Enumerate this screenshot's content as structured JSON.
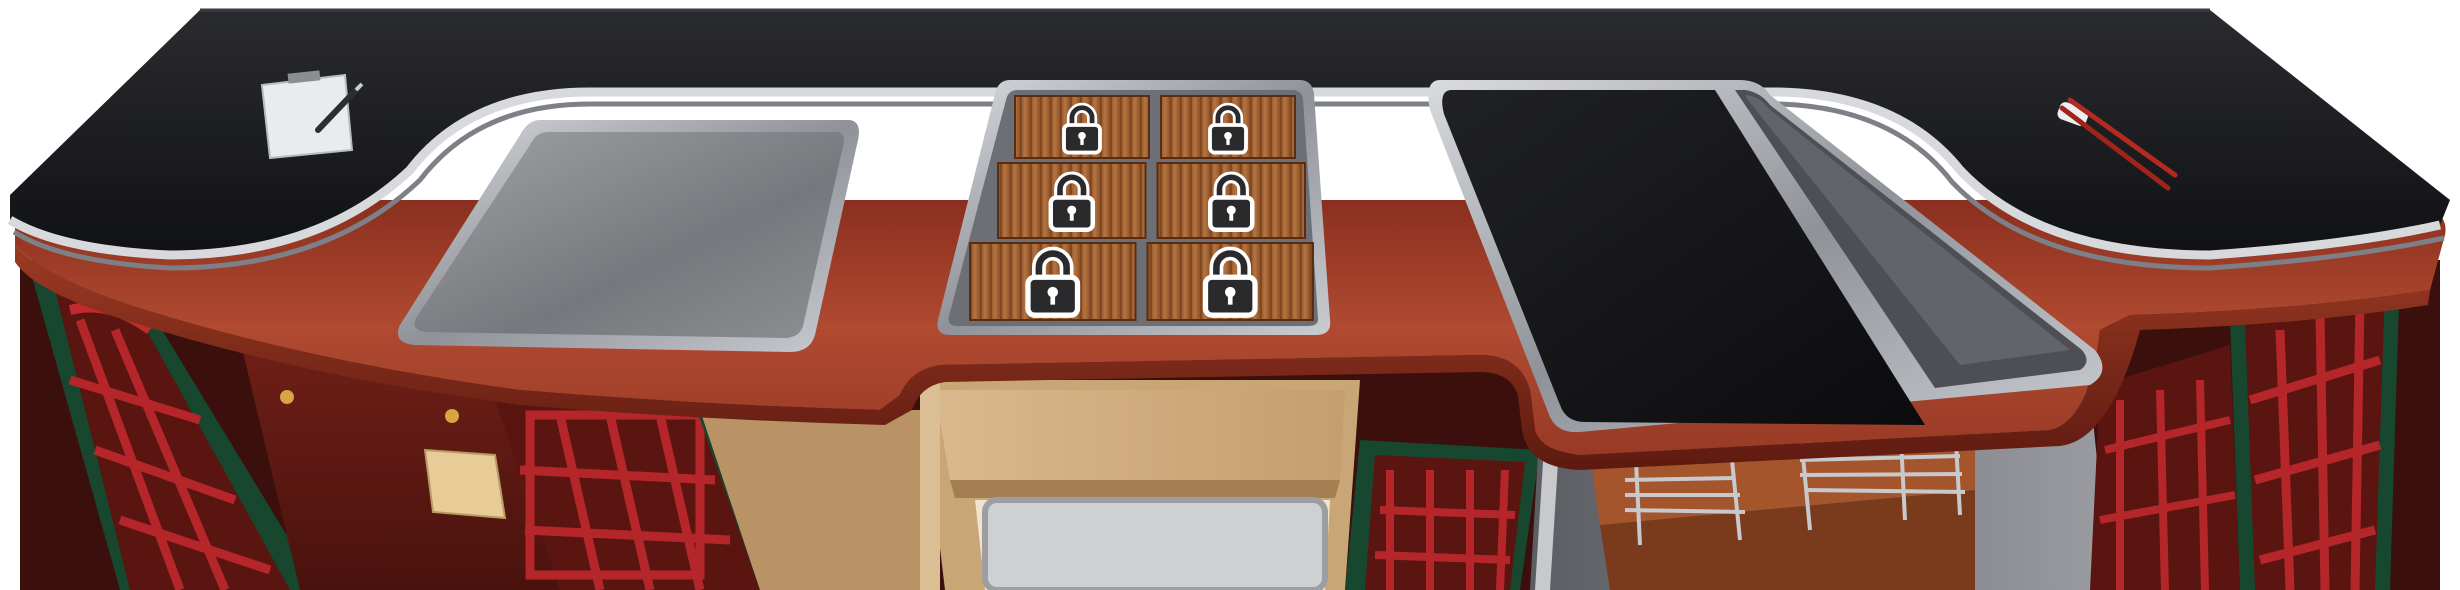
{
  "scene": {
    "type": "restaurant-kitchen-counter",
    "colors": {
      "countertop_black": "#1c1d20",
      "work_surface_red": "#a8402a",
      "cabinet_red": "#6b1d16",
      "lattice_green": "#1e5a3a",
      "steel": "#b9bcc2",
      "bamboo": "#a9683a",
      "stove_black": "#141416"
    }
  },
  "counter": {
    "left_tray": {
      "item": "steel-prep-tray"
    },
    "bamboo_mats": {
      "slots": [
        {
          "slot": "1",
          "locked": true
        },
        {
          "slot": "2",
          "locked": true
        },
        {
          "slot": "3",
          "locked": true
        },
        {
          "slot": "4",
          "locked": true
        },
        {
          "slot": "5",
          "locked": true
        },
        {
          "slot": "6",
          "locked": true
        }
      ]
    },
    "griddle": {
      "item": "black-griddle-plate"
    }
  },
  "decor": {
    "left": {
      "item": "clipboard-with-pen"
    },
    "right": {
      "item": "chopsticks-on-rest"
    }
  },
  "lower": {
    "cabinet_note": {
      "item": "sticky-note"
    },
    "open_shelf": {
      "item": "shelf-with-steel-tray"
    },
    "grill": {
      "item": "skewer-grill-rack"
    }
  }
}
